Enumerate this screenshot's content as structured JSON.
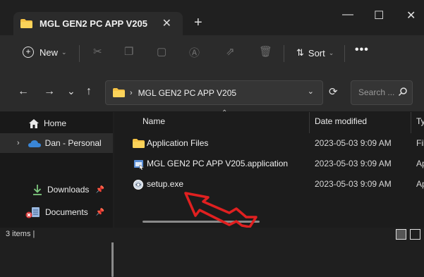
{
  "window": {
    "tab_title": "MGL GEN2 PC APP V205",
    "tab_close_glyph": "✕",
    "new_tab_glyph": "+",
    "minimize_glyph": "—",
    "maximize_glyph": "☐",
    "close_glyph": "✕"
  },
  "toolbar": {
    "new_label": "New",
    "sort_label": "Sort",
    "more_glyph": "•••",
    "icons": [
      "cut-icon",
      "copy-icon",
      "paste-icon",
      "rename-icon",
      "share-icon",
      "delete-icon",
      "sort-icon",
      "more-icon"
    ]
  },
  "nav": {
    "back_glyph": "←",
    "forward_glyph": "→",
    "recent_glyph": "⌄",
    "up_glyph": "↑",
    "refresh_glyph": "⟳",
    "address_sep_glyph": "›",
    "address_dropdown_glyph": "⌄",
    "address_path": "MGL GEN2 PC APP V205",
    "search_placeholder": "Search ..."
  },
  "sidebar": {
    "expand_glyph": "›",
    "pin_glyph": "📌",
    "items": [
      {
        "label": "Home",
        "icon": "home-icon"
      },
      {
        "label": "Dan - Personal",
        "icon": "onedrive-icon",
        "selected": true
      },
      {
        "label": "Downloads",
        "icon": "download-icon",
        "pinned": true
      },
      {
        "label": "Documents",
        "icon": "documents-icon",
        "pinned": true
      }
    ]
  },
  "columns": {
    "name": "Name",
    "date": "Date modified",
    "type": "Ty",
    "sort_glyph": "⌃"
  },
  "files": [
    {
      "name": "Application Files",
      "date": "2023-05-03 9:09 AM",
      "type": "Fil",
      "icon": "folder-icon"
    },
    {
      "name": "MGL GEN2 PC APP V205.application",
      "date": "2023-05-03 9:09 AM",
      "type": "Ap",
      "icon": "application-icon"
    },
    {
      "name": "setup.exe",
      "date": "2023-05-03 9:09 AM",
      "type": "Ap",
      "icon": "setup-icon"
    }
  ],
  "status": {
    "items_count": "3 items  |"
  },
  "colors": {
    "accent_folder": "#F6C244",
    "annotation_arrow": "#E02020",
    "onedrive": "#3A86D6"
  }
}
